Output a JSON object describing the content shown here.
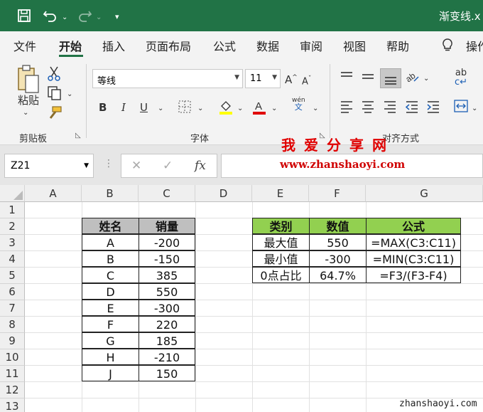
{
  "titlebar": {
    "save_icon": "save-icon",
    "undo_icon": "undo-icon",
    "redo_icon": "redo-icon",
    "filename": "渐变线.x"
  },
  "menu": {
    "tabs": [
      "文件",
      "开始",
      "插入",
      "页面布局",
      "公式",
      "数据",
      "审阅",
      "视图",
      "帮助"
    ],
    "active": "开始",
    "tell_me": "操作"
  },
  "ribbon": {
    "clipboard": {
      "paste_label": "粘贴",
      "group_label": "剪贴板"
    },
    "font": {
      "font_name": "等线",
      "font_size": "11",
      "group_label": "字体",
      "bold": "B",
      "italic": "I",
      "underline": "U",
      "phonetic_top": "wén",
      "phonetic_bottom": "文"
    },
    "alignment": {
      "group_label": "对齐方式"
    }
  },
  "formula_bar": {
    "name_box": "Z21",
    "cancel": "✕",
    "enter": "✓",
    "fx": "fx",
    "formula": ""
  },
  "grid": {
    "columns": [
      "A",
      "B",
      "C",
      "D",
      "E",
      "F",
      "G"
    ],
    "rows": [
      "1",
      "2",
      "3",
      "4",
      "5",
      "6",
      "7",
      "8",
      "9",
      "10",
      "11",
      "12",
      "13"
    ]
  },
  "table1": {
    "headers": [
      "姓名",
      "销量"
    ],
    "rows": [
      [
        "A",
        "-200"
      ],
      [
        "B",
        "-150"
      ],
      [
        "C",
        "385"
      ],
      [
        "D",
        "550"
      ],
      [
        "E",
        "-300"
      ],
      [
        "F",
        "220"
      ],
      [
        "G",
        "185"
      ],
      [
        "H",
        "-210"
      ],
      [
        "J",
        "150"
      ]
    ]
  },
  "table2": {
    "headers": [
      "类别",
      "数值",
      "公式"
    ],
    "rows": [
      [
        "最大值",
        "550",
        "=MAX(C3:C11)"
      ],
      [
        "最小值",
        "-300",
        "=MIN(C3:C11)"
      ],
      [
        "0点占比",
        "64.7%",
        "=F3/(F3-F4)"
      ]
    ]
  },
  "watermark": {
    "title": "我爱分享网",
    "url": "www.zhanshaoyi.com",
    "bottom": "zhanshaoyi.com"
  },
  "colors": {
    "accent": "#217346",
    "header_gray": "#bfbfbf",
    "header_green": "#92d050",
    "watermark_red": "#e00000"
  }
}
